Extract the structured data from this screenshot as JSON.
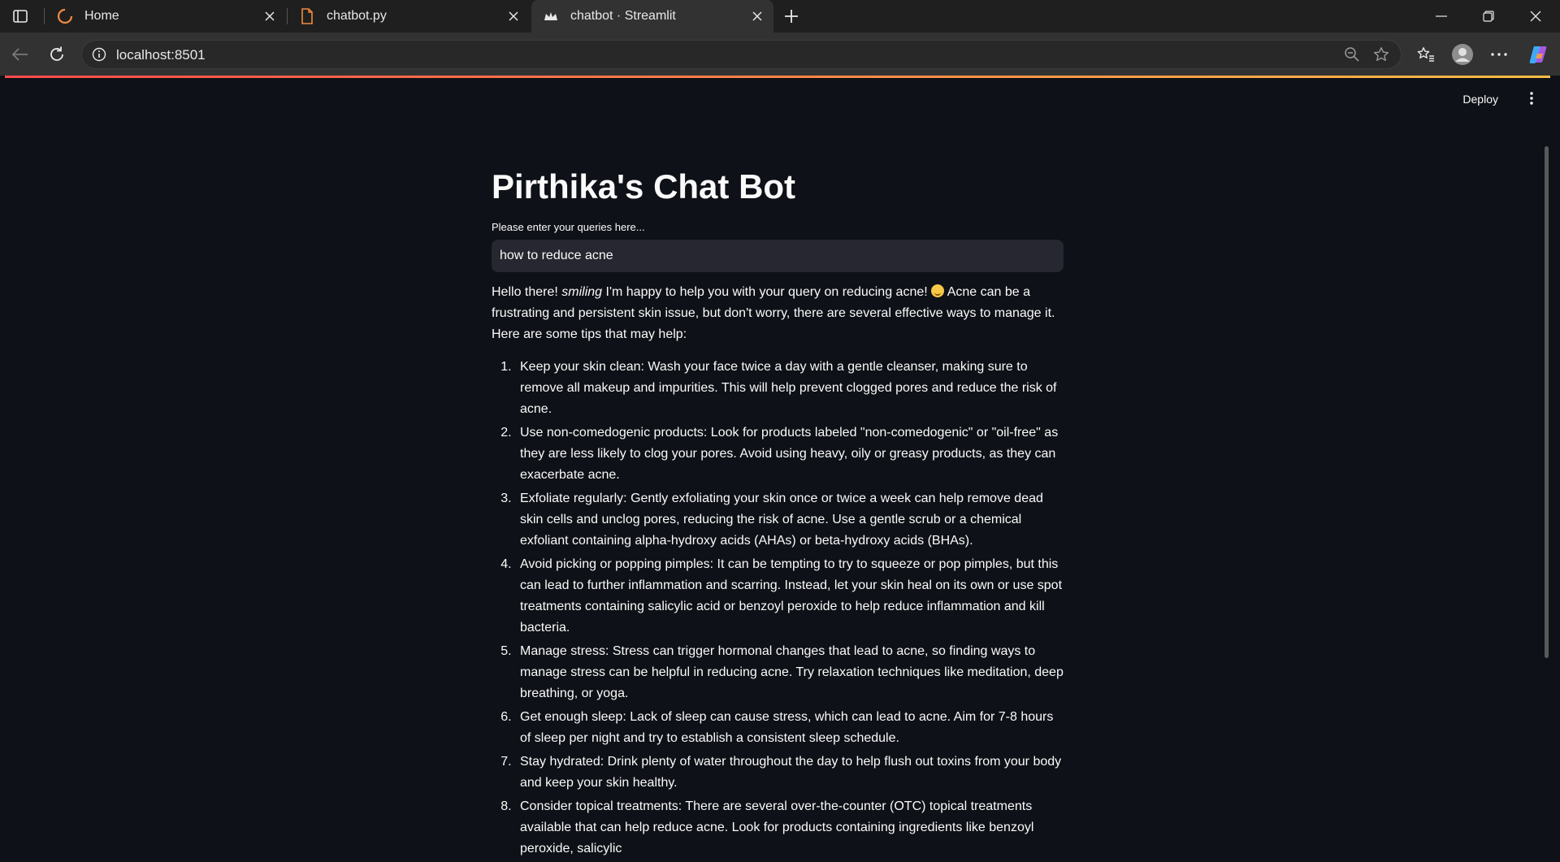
{
  "browser": {
    "tabs": [
      {
        "title": "Home",
        "icon": "loading-spinner-icon"
      },
      {
        "title": "chatbot.py",
        "icon": "file-icon"
      },
      {
        "title": "chatbot · Streamlit",
        "icon": "streamlit-crown-icon",
        "active": true
      }
    ],
    "url": "localhost:8501"
  },
  "app": {
    "deploy_label": "Deploy",
    "title": "Pirthika's Chat Bot",
    "input_label": "Please enter your queries here...",
    "input_value": "how to reduce acne",
    "response": {
      "intro_before": "Hello there! ",
      "intro_italic": "smiling",
      "intro_after_1": " I'm happy to help you with your query on reducing acne! ",
      "intro_after_2": " Acne can be a frustrating and persistent skin issue, but don't worry, there are several effective ways to manage it. Here are some tips that may help:",
      "tips": [
        "Keep your skin clean: Wash your face twice a day with a gentle cleanser, making sure to remove all makeup and impurities. This will help prevent clogged pores and reduce the risk of acne.",
        "Use non-comedogenic products: Look for products labeled \"non-comedogenic\" or \"oil-free\" as they are less likely to clog your pores. Avoid using heavy, oily or greasy products, as they can exacerbate acne.",
        "Exfoliate regularly: Gently exfoliating your skin once or twice a week can help remove dead skin cells and unclog pores, reducing the risk of acne. Use a gentle scrub or a chemical exfoliant containing alpha-hydroxy acids (AHAs) or beta-hydroxy acids (BHAs).",
        "Avoid picking or popping pimples: It can be tempting to try to squeeze or pop pimples, but this can lead to further inflammation and scarring. Instead, let your skin heal on its own or use spot treatments containing salicylic acid or benzoyl peroxide to help reduce inflammation and kill bacteria.",
        "Manage stress: Stress can trigger hormonal changes that lead to acne, so finding ways to manage stress can be helpful in reducing acne. Try relaxation techniques like meditation, deep breathing, or yoga.",
        "Get enough sleep: Lack of sleep can cause stress, which can lead to acne. Aim for 7-8 hours of sleep per night and try to establish a consistent sleep schedule.",
        "Stay hydrated: Drink plenty of water throughout the day to help flush out toxins from your body and keep your skin healthy.",
        "Consider topical treatments: There are several over-the-counter (OTC) topical treatments available that can help reduce acne. Look for products containing ingredients like benzoyl peroxide, salicylic"
      ]
    }
  },
  "colors": {
    "page_bg": "#0e1117",
    "input_bg": "#262730",
    "accent_start": "#ff4b4b",
    "accent_end": "#ffbd45"
  }
}
